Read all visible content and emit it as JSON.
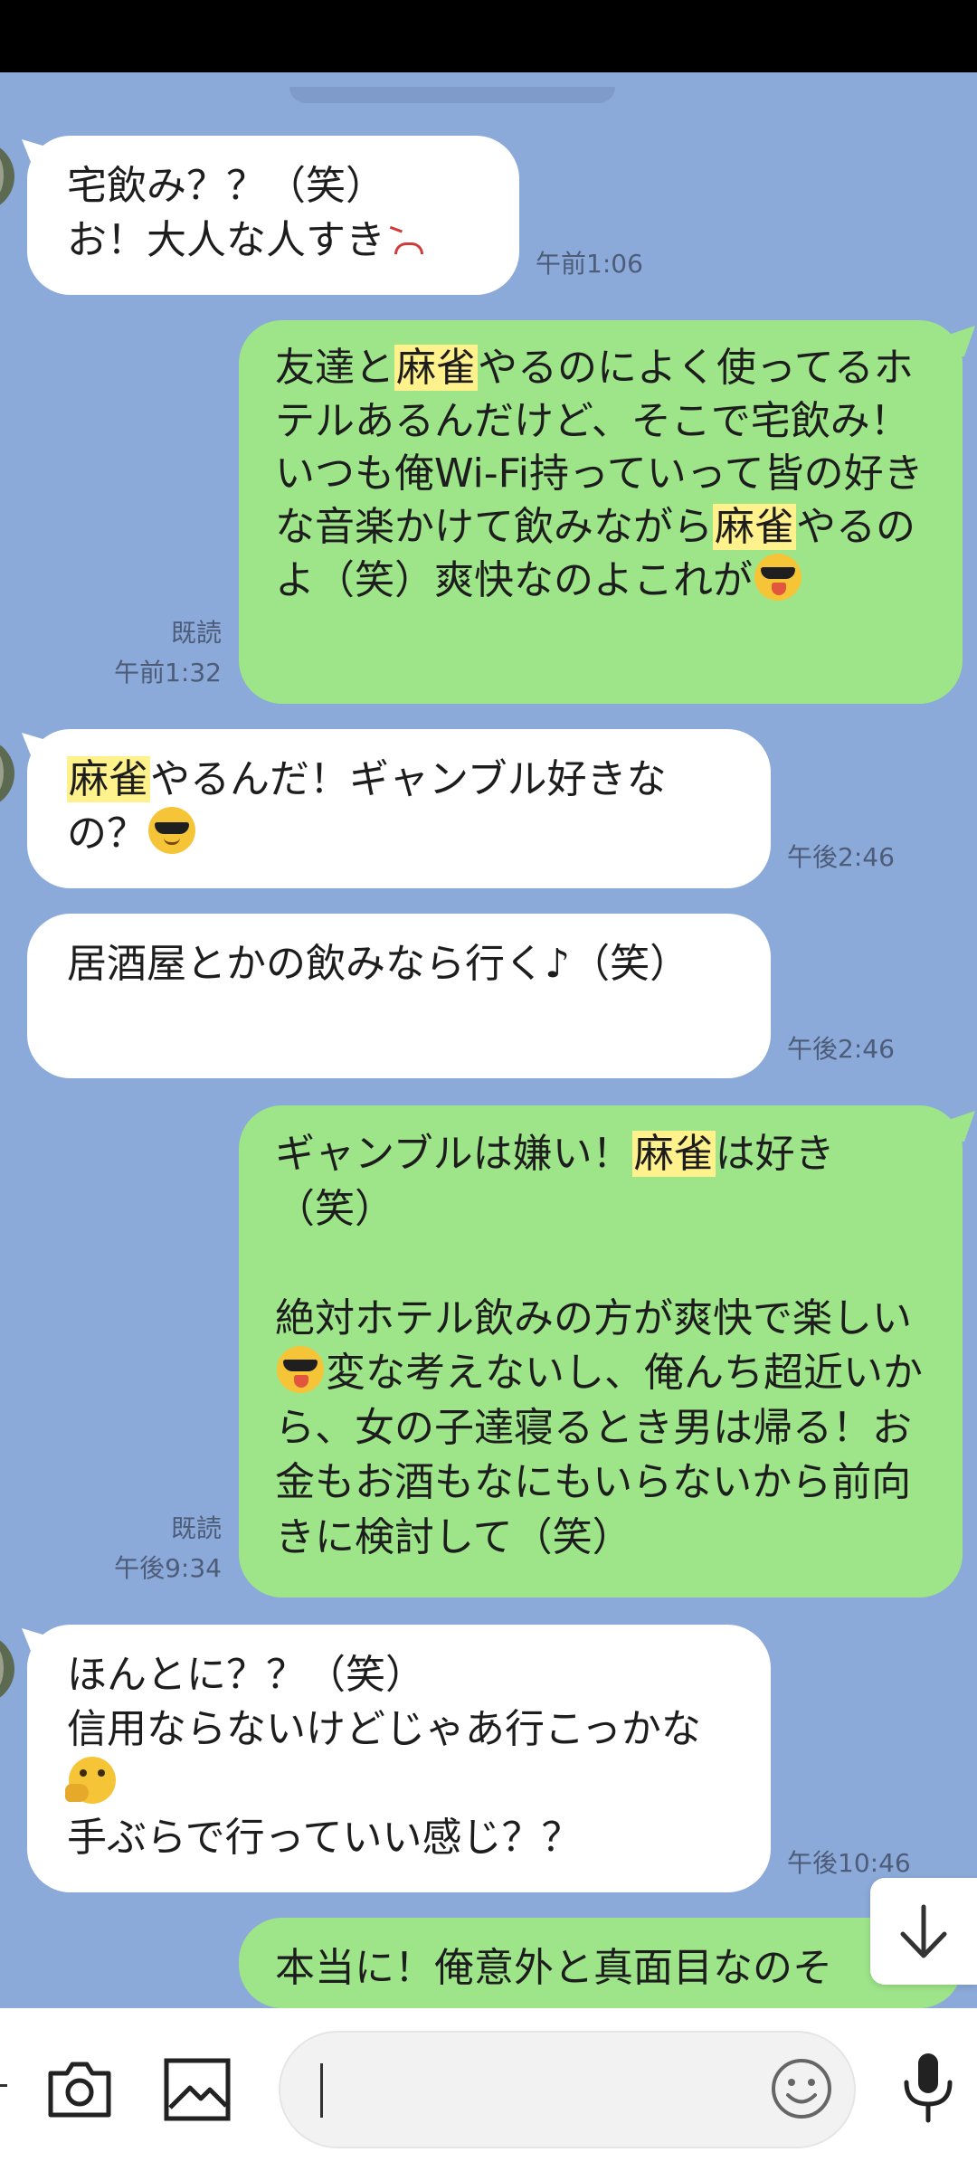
{
  "messages": [
    {
      "id": "m1",
      "direction": "in",
      "parts": [
        {
          "t": "宅飲み？？（笑）\nお！大人な人すき"
        },
        {
          "emoji": "sad-face"
        }
      ],
      "time": "午前1:06",
      "read": ""
    },
    {
      "id": "m2",
      "direction": "out",
      "parts": [
        {
          "t": "友達と"
        },
        {
          "hl": "麻雀"
        },
        {
          "t": "やるのによく使ってるホテルあるんだけど、そこで宅飲み！いつも俺Wi-Fi持っていって皆の好きな音楽かけて飲みながら"
        },
        {
          "hl": "麻雀"
        },
        {
          "t": "やるのよ（笑）爽快なのよこれが"
        },
        {
          "emoji": "tongue-sunglasses"
        }
      ],
      "time": "午前1:32",
      "read": "既読"
    },
    {
      "id": "m3",
      "direction": "in",
      "parts": [
        {
          "hl": "麻雀"
        },
        {
          "t": "やるんだ！ギャンブル好きなの？"
        },
        {
          "emoji": "sunglasses-face"
        }
      ],
      "time": "午後2:46",
      "read": ""
    },
    {
      "id": "m4",
      "direction": "in",
      "parts": [
        {
          "t": "居酒屋とかの飲みなら行く♪（笑）"
        }
      ],
      "time": "午後2:46",
      "read": ""
    },
    {
      "id": "m5",
      "direction": "out",
      "parts": [
        {
          "t": "ギャンブルは嫌い！"
        },
        {
          "hl": "麻雀"
        },
        {
          "t": "は好き（笑）\n\n絶対ホテル飲みの方が爽快で楽しい"
        },
        {
          "emoji": "tongue-sunglasses"
        },
        {
          "t": "変な考えないし、俺んち超近いから、女の子達寝るとき男は帰る！お金もお酒もなにもいらないから前向きに検討して（笑）"
        }
      ],
      "time": "午後9:34",
      "read": "既読"
    },
    {
      "id": "m6",
      "direction": "in",
      "parts": [
        {
          "t": "ほんとに？？（笑）\n信用ならないけどじゃあ行こっかな"
        },
        {
          "emoji": "thinking-face"
        },
        {
          "t": "\n手ぶらで行っていい感じ？？"
        }
      ],
      "time": "午後10:46",
      "read": ""
    },
    {
      "id": "m7",
      "direction": "out",
      "parts": [
        {
          "t": "本当に！俺意外と真面目なのそ"
        }
      ],
      "time": "",
      "read": ""
    }
  ],
  "composer": {
    "placeholder": ""
  },
  "icons": {
    "camera": "camera-icon",
    "gallery": "image-icon",
    "emoji": "emoji-icon",
    "mic": "microphone-icon",
    "scroll": "arrow-down-icon"
  },
  "colors": {
    "background": "#8caad9",
    "incoming": "#ffffff",
    "outgoing": "#9ee58a",
    "highlight": "#fff18c"
  }
}
